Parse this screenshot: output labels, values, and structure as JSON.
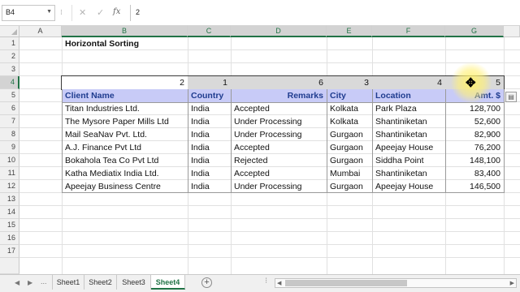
{
  "formula_bar": {
    "name_box": "B4",
    "more": "⁝",
    "cancel_glyph": "✕",
    "enter_glyph": "✓",
    "function_glyph": "fx",
    "formula": "2"
  },
  "columns": [
    "A",
    "B",
    "C",
    "D",
    "E",
    "F",
    "G"
  ],
  "rows": [
    "1",
    "2",
    "3",
    "4",
    "5",
    "6",
    "7",
    "8",
    "9",
    "10",
    "11",
    "12",
    "13",
    "14",
    "15",
    "16",
    "17"
  ],
  "title": "Horizontal Sorting",
  "sort_keys": [
    "2",
    "1",
    "6",
    "3",
    "4",
    "5"
  ],
  "table": {
    "headers": [
      "Client Name",
      "Country",
      "Remarks",
      "City",
      "Location",
      "Amt. $"
    ],
    "rows": [
      [
        "Titan Industries Ltd.",
        "India",
        "Accepted",
        "Kolkata",
        "Park Plaza",
        "128,700"
      ],
      [
        "The Mysore Paper Mills Ltd",
        "India",
        "Under Processing",
        "Kolkata",
        "Shantiniketan",
        "52,600"
      ],
      [
        "Mail SeaNav Pvt. Ltd.",
        "India",
        "Under Processing",
        "Gurgaon",
        "Shantiniketan",
        "82,900"
      ],
      [
        "A.J. Finance Pvt Ltd",
        "India",
        "Accepted",
        "Gurgaon",
        "Apeejay House",
        "76,200"
      ],
      [
        "Bokahola Tea Co Pvt Ltd",
        "India",
        "Rejected",
        "Gurgaon",
        "Siddha Point",
        "148,100"
      ],
      [
        "Katha Mediatix India Ltd.",
        "India",
        "Accepted",
        "Mumbai",
        "Shantiniketan",
        "83,400"
      ],
      [
        "Apeejay Business Centre",
        "India",
        "Under Processing",
        "Gurgaon",
        "Apeejay House",
        "146,500"
      ]
    ]
  },
  "sheets": [
    "Sheet1",
    "Sheet2",
    "Sheet3",
    "Sheet4"
  ],
  "active_sheet": "Sheet4",
  "tab_nav": {
    "prev": "◀",
    "next": "▶",
    "more": "..."
  },
  "add_sheet": "+",
  "paste_options_glyph": "▤",
  "cursor_glyph": "✥",
  "colors": {
    "header_band": "#c8cbf7",
    "header_text": "#1f3c8f",
    "selection": "#d9d9d9",
    "excel_green": "#217346"
  }
}
